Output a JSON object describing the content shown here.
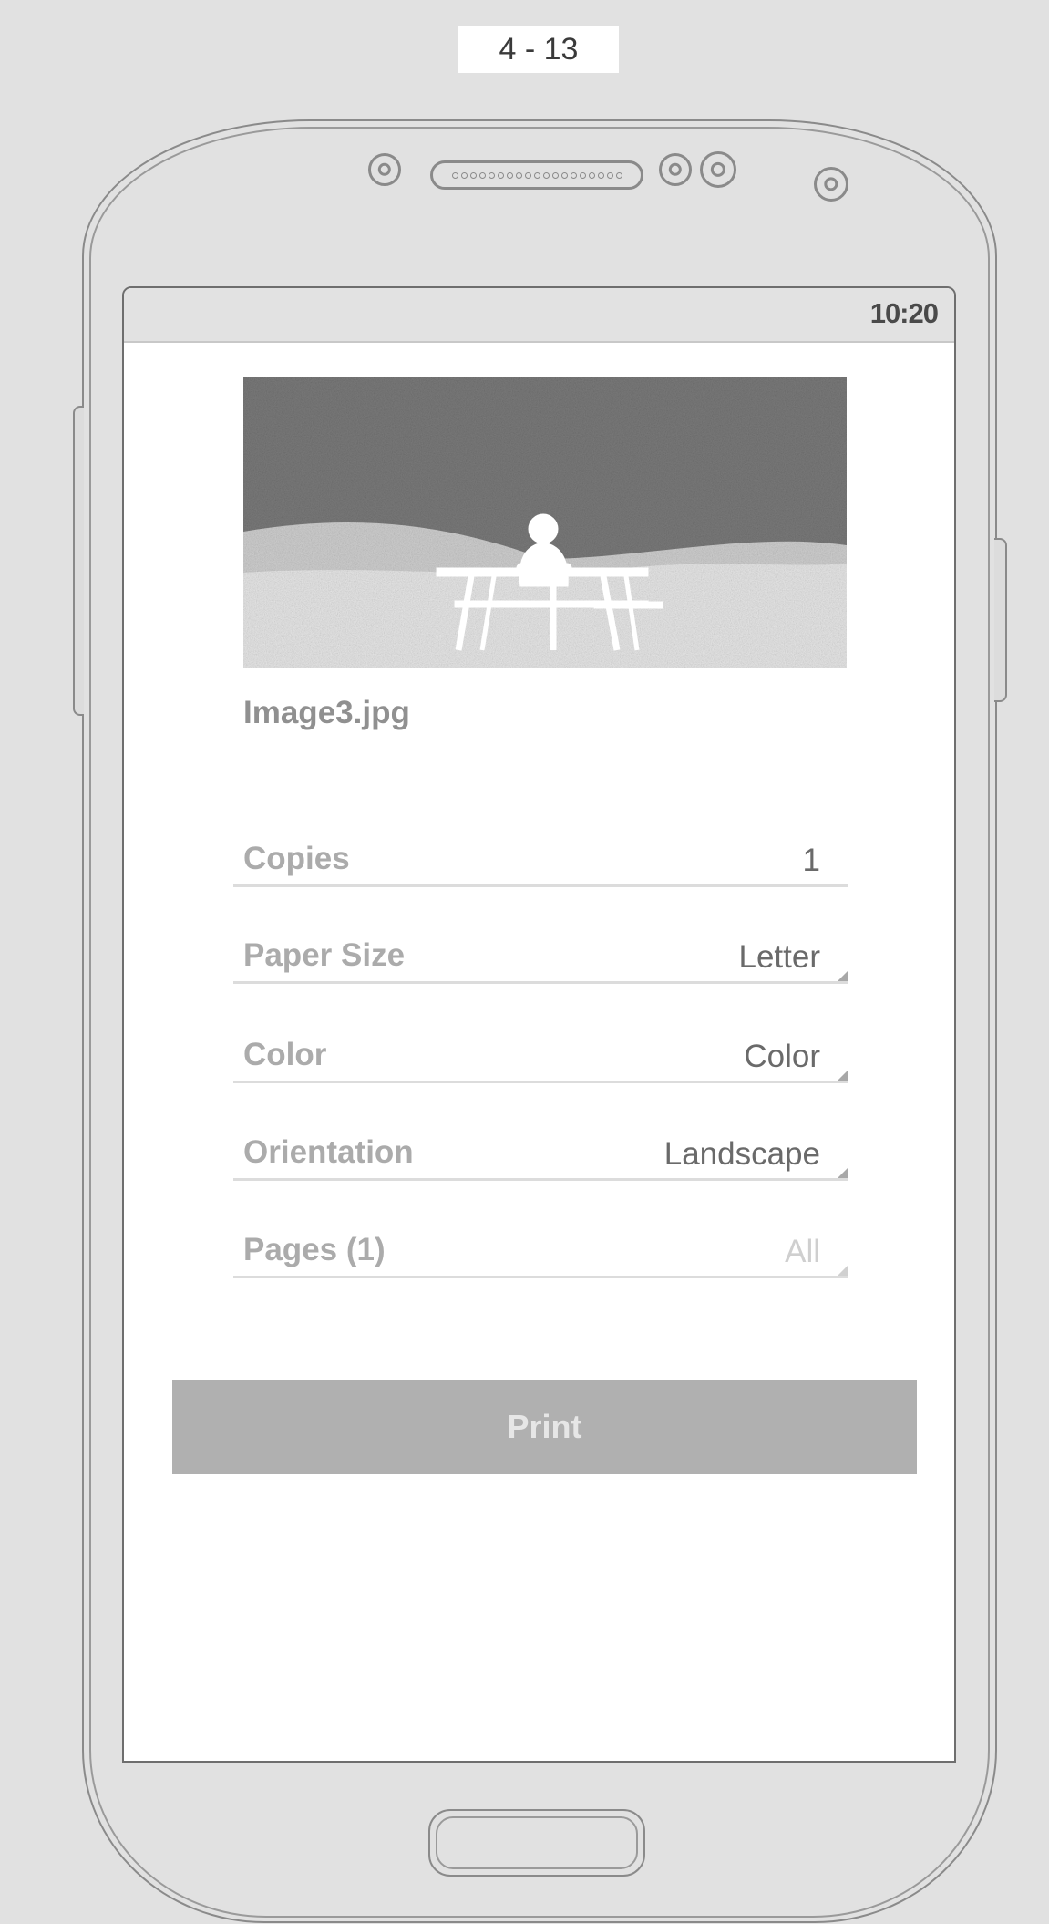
{
  "page_label": "4 - 13",
  "status_bar": {
    "time": "10:20"
  },
  "file": {
    "name": "Image3.jpg"
  },
  "settings": [
    {
      "label": "Copies",
      "value": "1"
    },
    {
      "label": "Paper Size",
      "value": "Letter"
    },
    {
      "label": "Color",
      "value": "Color"
    },
    {
      "label": "Orientation",
      "value": "Landscape"
    },
    {
      "label": "Pages (1)",
      "value": "All"
    }
  ],
  "print_button": {
    "label": "Print"
  },
  "icons": {
    "preview": "image-preview",
    "dropdown": "dropdown-caret-icon"
  },
  "colors": {
    "background": "#e1e1e1",
    "screen": "#ffffff",
    "button": "#b0b0b0",
    "label": "#ababab",
    "value": "#6a6a6a"
  }
}
